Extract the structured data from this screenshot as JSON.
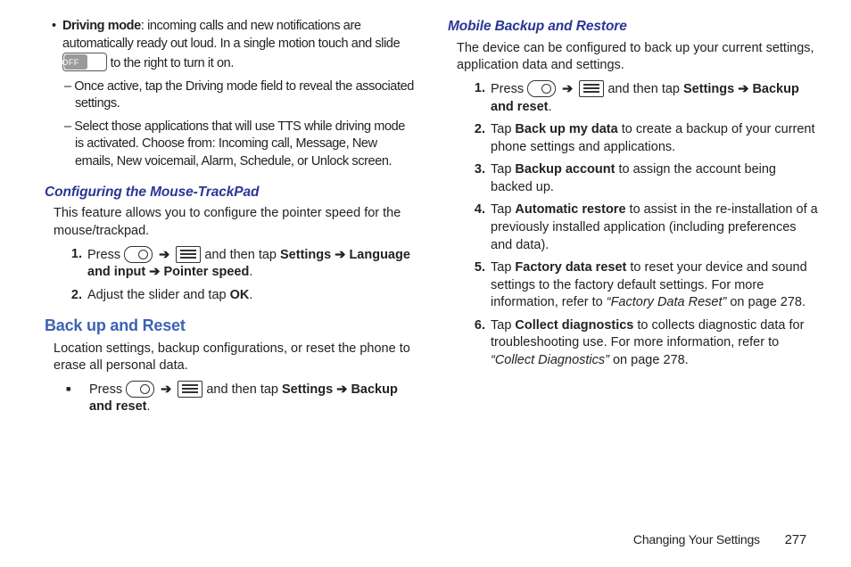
{
  "left": {
    "driving_mode": {
      "label": "Driving mode",
      "desc1": ": incoming calls and new notifications are automatically ready out loud. In a single motion touch and slide ",
      "desc2": " to the right to turn it on.",
      "toggle_text": "OFF",
      "sub1": "Once active, tap the Driving mode field to reveal the associated settings.",
      "sub2": "Select those applications that will use TTS while driving mode is activated. Choose from: Incoming call, Message, New emails, New voicemail, Alarm, Schedule, or Unlock screen."
    },
    "config_heading": "Configuring the Mouse-TrackPad",
    "config_intro": "This feature allows you to configure the pointer speed for the mouse/trackpad.",
    "step1": {
      "pre": "Press ",
      "mid": " and then tap ",
      "b1": "Settings",
      "arrow": " ➔ ",
      "b2": "Language and input",
      "b3": "Pointer speed",
      "end": "."
    },
    "step2": {
      "pre": "Adjust the slider and tap ",
      "b": "OK",
      "end": "."
    },
    "backup_heading": "Back up and Reset",
    "backup_intro": "Location settings, backup configurations, or reset the phone to erase all personal data.",
    "sqstep": {
      "pre": "Press ",
      "mid": " and then tap ",
      "b1": "Settings",
      "arrow": " ➔ ",
      "b2": "Backup and reset",
      "end": "."
    }
  },
  "right": {
    "mbr_heading": "Mobile Backup and Restore",
    "mbr_intro": "The device can be configured to back up your current settings, application data and settings.",
    "s1": {
      "pre": "Press ",
      "mid": " and then tap ",
      "b1": "Settings",
      "arrow": " ➔ ",
      "b2": "Backup and reset",
      "end": "."
    },
    "s2": {
      "pre": "Tap ",
      "b": "Back up my data",
      "post": " to create a backup of your current phone settings and applications."
    },
    "s3": {
      "pre": "Tap ",
      "b": "Backup account",
      "post": " to assign the account being backed up."
    },
    "s4": {
      "pre": "Tap ",
      "b": "Automatic restore",
      "post": " to assist in the re-installation of a previously installed application (including preferences and data)."
    },
    "s5": {
      "pre": "Tap ",
      "b": "Factory data reset",
      "post1": " to reset your device and sound settings to the factory default settings. For more information, refer to ",
      "ref": "“Factory Data Reset”",
      "post2": "  on page 278."
    },
    "s6": {
      "pre": "Tap ",
      "b": "Collect diagnostics",
      "post1": " to collects diagnostic data for troubleshooting use. For more information, refer to ",
      "ref": "“Collect Diagnostics”",
      "post2": "  on page 278."
    }
  },
  "footer": {
    "title": "Changing Your Settings",
    "page": "277"
  }
}
